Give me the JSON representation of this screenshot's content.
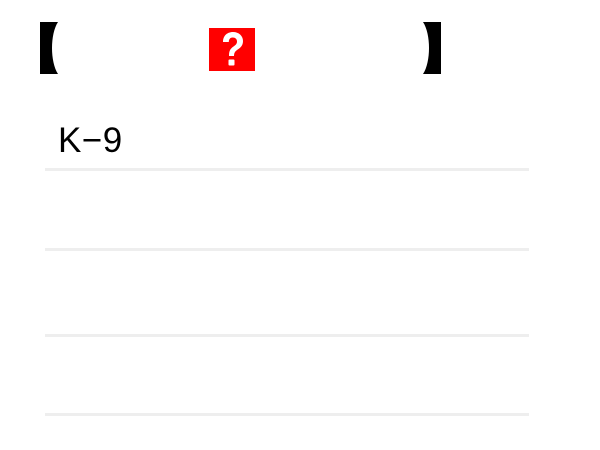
{
  "header": {
    "left_bracket_icon": "black-lenticular-bracket-left",
    "right_bracket_icon": "black-lenticular-bracket-right",
    "badge_icon": "question-mark-icon",
    "badge_color": "#ff0000",
    "bracket_color": "#000000"
  },
  "list": {
    "rows": [
      {
        "text": "K−9"
      },
      {
        "text": ""
      },
      {
        "text": ""
      },
      {
        "text": ""
      }
    ],
    "divider_color": "#eeeeee"
  }
}
